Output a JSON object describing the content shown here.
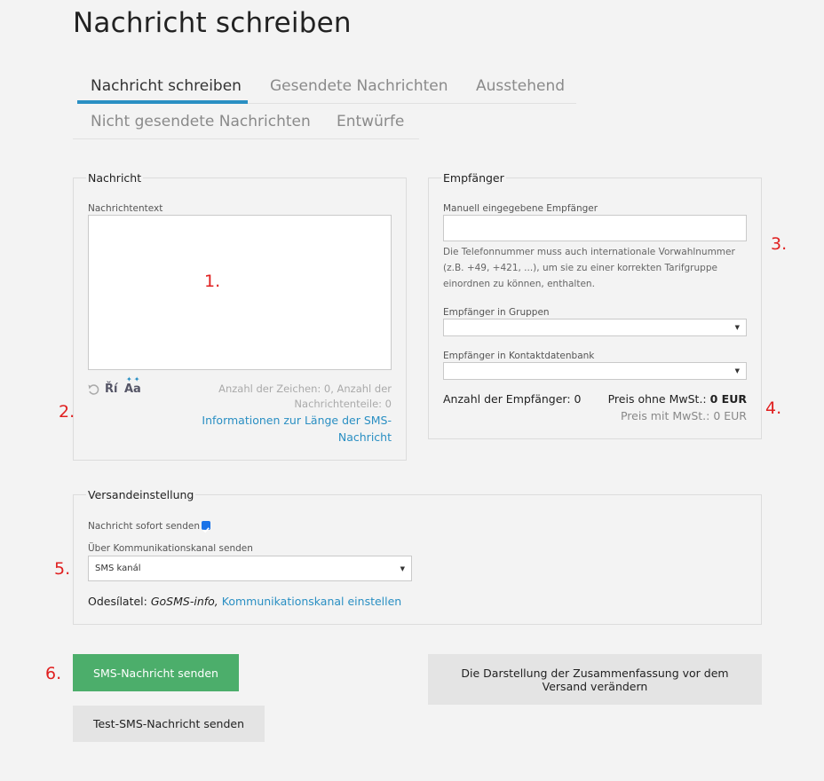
{
  "page": {
    "title": "Nachricht schreiben"
  },
  "tabs": [
    {
      "label": "Nachricht schreiben",
      "active": true
    },
    {
      "label": "Gesendete Nachrichten",
      "active": false
    },
    {
      "label": "Ausstehend",
      "active": false
    },
    {
      "label": "Nicht gesendete Nachrichten",
      "active": false
    },
    {
      "label": "Entwürfe",
      "active": false
    }
  ],
  "message": {
    "legend": "Nachricht",
    "text_label": "Nachrichtentext",
    "text_value": "",
    "icons": [
      "undo-icon",
      "diacritics-icon",
      "font-case-icon"
    ],
    "icon_text_ri": "Ří",
    "icon_text_aa": "Aa",
    "char_count": "Anzahl der Zeichen: 0, Anzahl der",
    "parts_count": "Nachrichtenteile: 0",
    "info_link_line1": "Informationen zur Länge der SMS-",
    "info_link_line2": "Nachricht"
  },
  "recipients": {
    "legend": "Empfänger",
    "manual_label": "Manuell eingegebene Empfänger",
    "manual_value": "",
    "help_line1": "Die Telefonnummer muss auch internationale Vorwahlnummer",
    "help_line2": "(z.B. +49, +421, ...), um sie zu einer korrekten Tarifgruppe",
    "help_line3": "einordnen zu können, enthalten.",
    "groups_label": "Empfänger in Gruppen",
    "groups_value": "",
    "contacts_label": "Empfänger in Kontaktdatenbank",
    "contacts_value": "",
    "count_text": "Anzahl der Empfänger: 0",
    "price_net_label": "Preis ohne MwSt.:",
    "price_net_value": "0 EUR",
    "price_gross": "Preis mit MwSt.: 0 EUR"
  },
  "send_settings": {
    "legend": "Versandeinstellung",
    "send_now_label": "Nachricht sofort senden",
    "send_now_checked": true,
    "channel_label": "Über Kommunikationskanal senden",
    "channel_value": "SMS kanál",
    "sender_prefix": "Odesílatel:",
    "sender_name": "GoSMS-info,",
    "channel_link": "Kommunikationskanal einstellen"
  },
  "buttons": {
    "send": "SMS-Nachricht senden",
    "test": "Test-SMS-Nachricht senden",
    "summary_line1": "Die Darstellung der Zusammenfassung vor dem",
    "summary_line2": "Versand verändern"
  },
  "markers": [
    "1.",
    "2.",
    "3.",
    "4.",
    "5.",
    "6."
  ],
  "colors": {
    "accent": "#2a8fc3",
    "primary_button": "#4cae6b",
    "marker": "#e02020",
    "background": "#f3f3f3"
  }
}
